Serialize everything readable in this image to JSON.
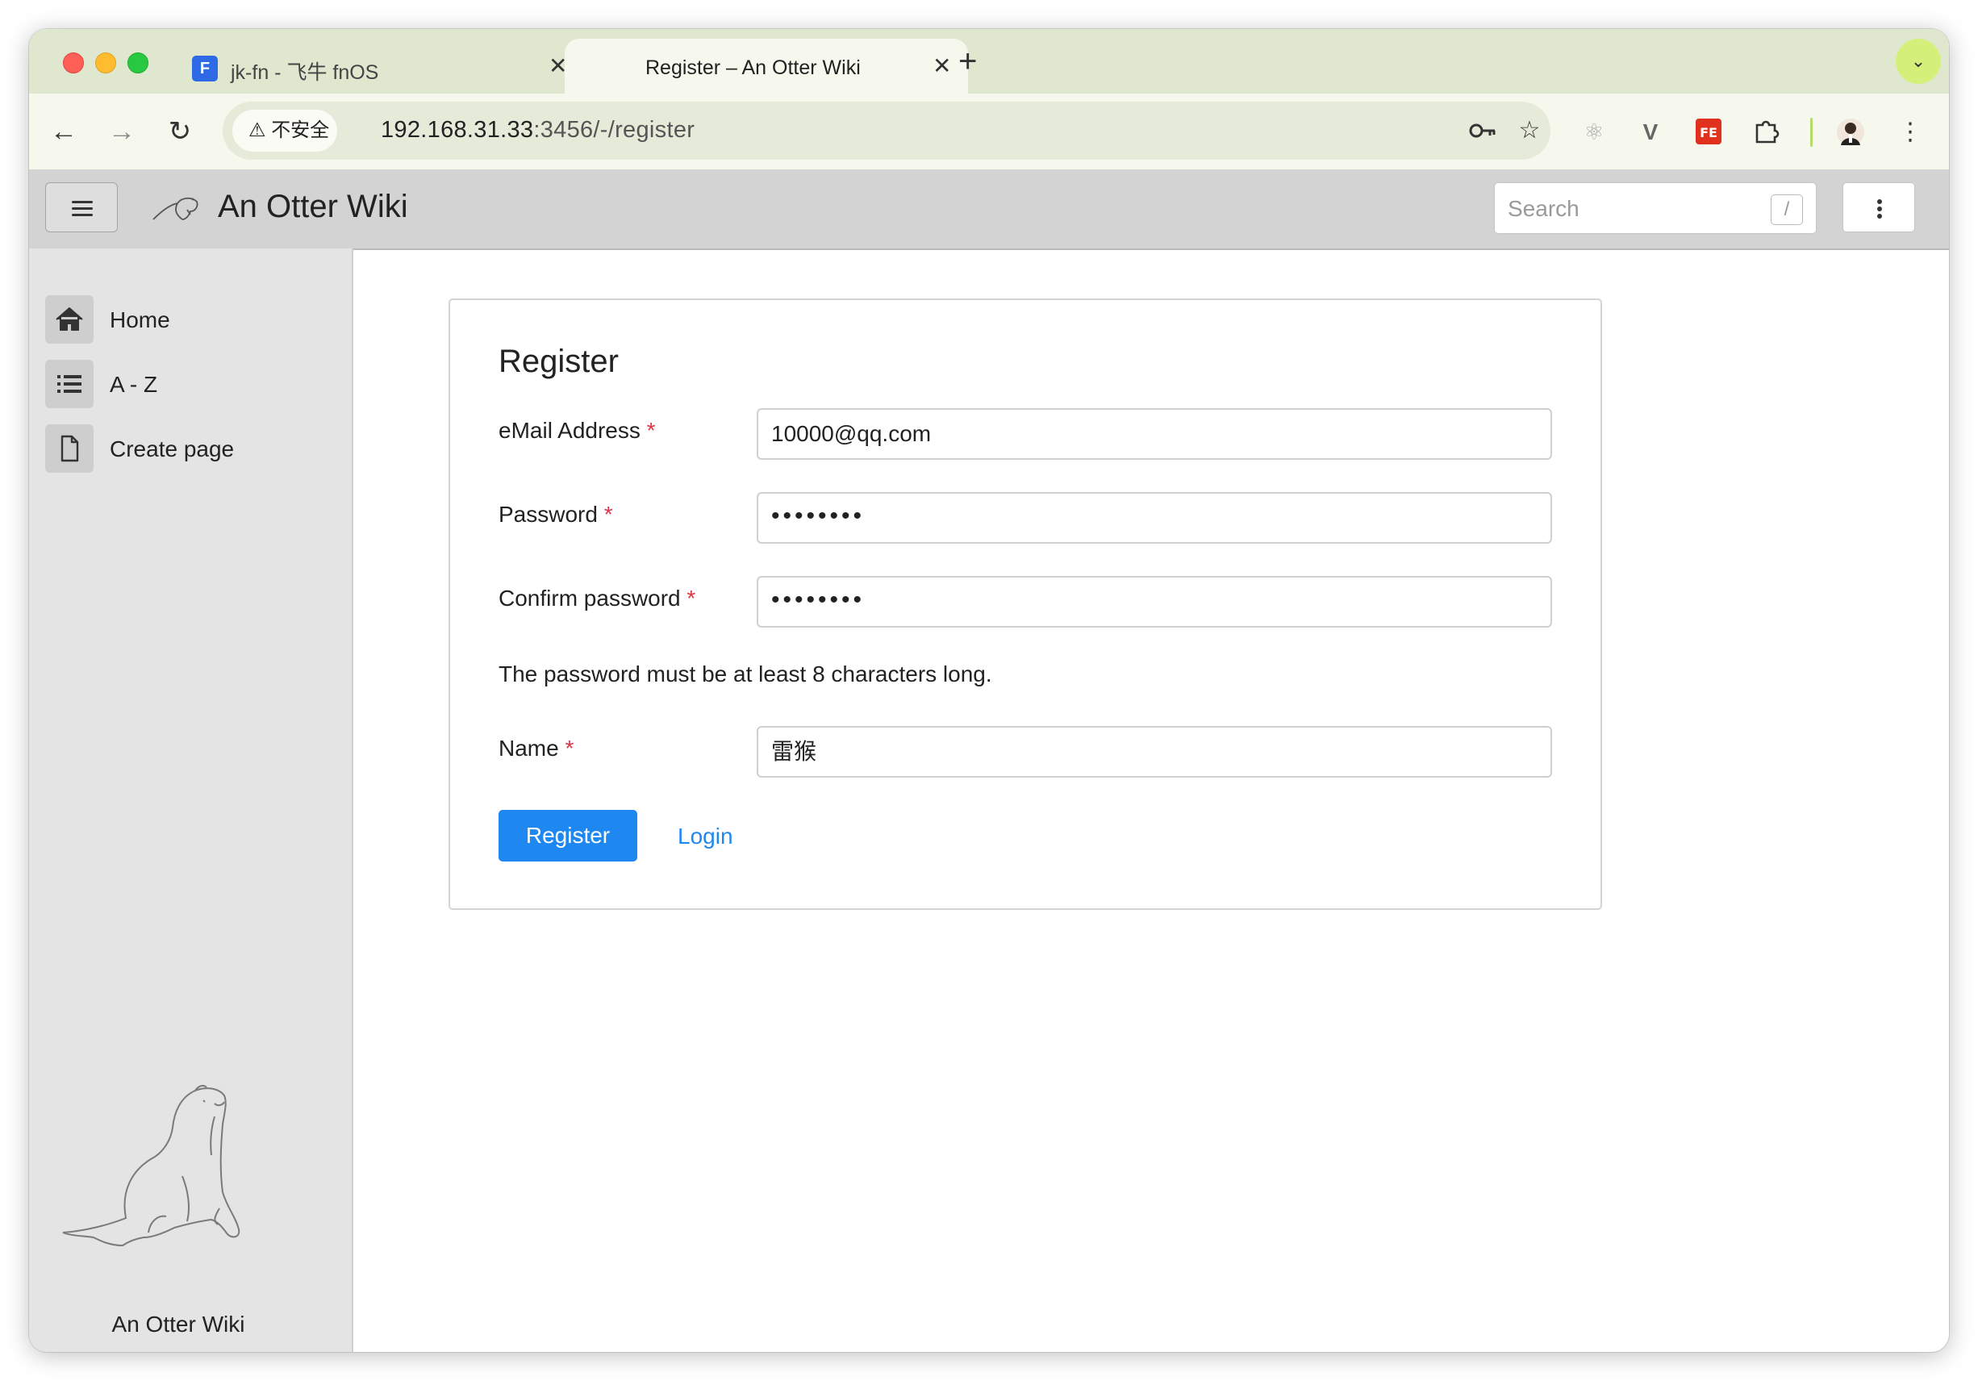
{
  "browser": {
    "tabs": [
      {
        "title": "jk-fn - 飞牛 fnOS",
        "icon": "fnos-icon",
        "active": false
      },
      {
        "title": "Register – An Otter Wiki",
        "active": true
      }
    ],
    "security_chip": "不安全",
    "url_host": "192.168.31.33",
    "url_rest": ":3456/-/register",
    "accent_color": "#d5f07a"
  },
  "app": {
    "title": "An Otter Wiki",
    "search_placeholder": "Search",
    "search_shortcut": "/"
  },
  "sidebar": {
    "items": [
      {
        "label": "Home",
        "icon": "home-icon"
      },
      {
        "label": "A - Z",
        "icon": "list-icon"
      },
      {
        "label": "Create page",
        "icon": "file-icon"
      }
    ],
    "footer": "An Otter Wiki"
  },
  "form": {
    "title": "Register",
    "email_label": "eMail Address",
    "email_value": "10000@qq.com",
    "password_label": "Password",
    "password_value": "••••••••",
    "confirm_label": "Confirm password",
    "confirm_value": "••••••••",
    "required_mark": "*",
    "hint": "The password must be at least 8 characters long.",
    "name_label": "Name",
    "name_value": "雷猴",
    "register_button": "Register",
    "login_link": "Login",
    "primary_color": "#1e88f0"
  }
}
